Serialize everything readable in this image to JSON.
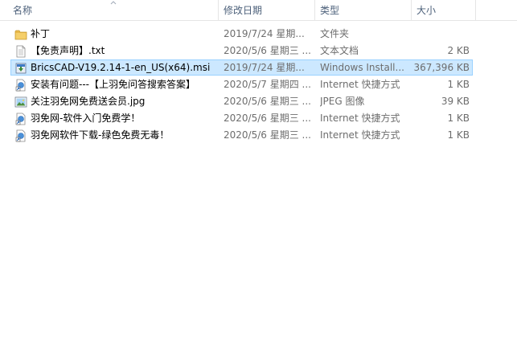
{
  "columns": {
    "name": "名称",
    "date": "修改日期",
    "type": "类型",
    "size": "大小"
  },
  "files": [
    {
      "name": "补丁",
      "date": "2019/7/24 星期...",
      "type": "文件夹",
      "size": "",
      "icon": "folder-icon"
    },
    {
      "name": "【免责声明】.txt",
      "date": "2020/5/6 星期三 ...",
      "type": "文本文档",
      "size": "2 KB",
      "icon": "text-file-icon"
    },
    {
      "name": "BricsCAD-V19.2.14-1-en_US(x64).msi",
      "date": "2019/7/24 星期...",
      "type": "Windows Install...",
      "size": "367,396 KB",
      "icon": "msi-installer-icon",
      "selected": true
    },
    {
      "name": "安装有问题---【上羽免问答搜索答案】",
      "date": "2020/5/7 星期四 ...",
      "type": "Internet 快捷方式",
      "size": "1 KB",
      "icon": "internet-shortcut-icon"
    },
    {
      "name": "关注羽免网免费送会员.jpg",
      "date": "2020/5/6 星期三 ...",
      "type": "JPEG 图像",
      "size": "39 KB",
      "icon": "image-file-icon"
    },
    {
      "name": "羽免网-软件入门免费学！",
      "date": "2020/5/6 星期三 ...",
      "type": "Internet 快捷方式",
      "size": "1 KB",
      "icon": "internet-shortcut-icon"
    },
    {
      "name": "羽免网软件下载-绿色免费无毒！",
      "date": "2020/5/6 星期三 ...",
      "type": "Internet 快捷方式",
      "size": "1 KB",
      "icon": "internet-shortcut-icon"
    }
  ]
}
